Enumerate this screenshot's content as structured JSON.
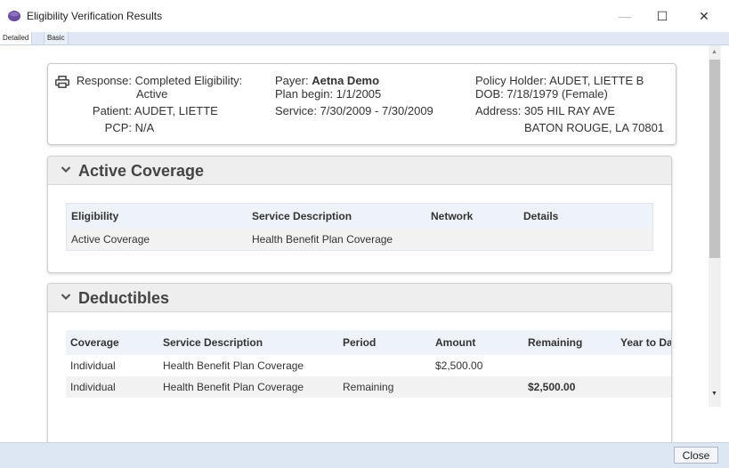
{
  "window": {
    "title": "Eligibility Verification Results",
    "minimize": "—",
    "maximize": "☐",
    "close": "✕"
  },
  "tabs": [
    {
      "label": "Detailed",
      "active": true
    },
    {
      "label": "Basic",
      "active": false
    }
  ],
  "summary": {
    "response_label": "Response:",
    "response_value_1": "Completed  Eligibility:",
    "response_value_2": "Active",
    "patient_label": "Patient:",
    "patient_value": "AUDET, LIETTE",
    "pcp_label": "PCP:",
    "pcp_value": "N/A",
    "payer_label": "Payer:",
    "payer_value": "Aetna Demo",
    "plan_begin": "Plan begin: 1/1/2005",
    "service": "Service: 7/30/2009 - 7/30/2009",
    "policy_holder": "Policy Holder: AUDET, LIETTE B",
    "dob": "DOB: 7/18/1979 (Female)",
    "address_1": "Address: 305 HIL RAY AVE",
    "address_2": "BATON ROUGE, LA 70801"
  },
  "active_coverage": {
    "title": "Active Coverage",
    "columns": [
      "Eligibility",
      "Service Description",
      "Network",
      "Details"
    ],
    "rows": [
      [
        "Active Coverage",
        "Health Benefit Plan Coverage",
        "",
        ""
      ]
    ]
  },
  "deductibles": {
    "title": "Deductibles",
    "columns": [
      "Coverage",
      "Service Description",
      "Period",
      "Amount",
      "Remaining",
      "Year to Date"
    ],
    "rows": [
      [
        "Individual",
        "Health Benefit Plan Coverage",
        "",
        "$2,500.00",
        "",
        ""
      ],
      [
        "Individual",
        "Health Benefit Plan Coverage",
        "Remaining",
        "",
        "$2,500.00",
        ""
      ]
    ]
  },
  "footer": {
    "close_label": "Close"
  },
  "colors": {
    "accent": "#6a4c9c",
    "tabbar": "#dfe8f4",
    "panel_header": "#eeeeee"
  }
}
